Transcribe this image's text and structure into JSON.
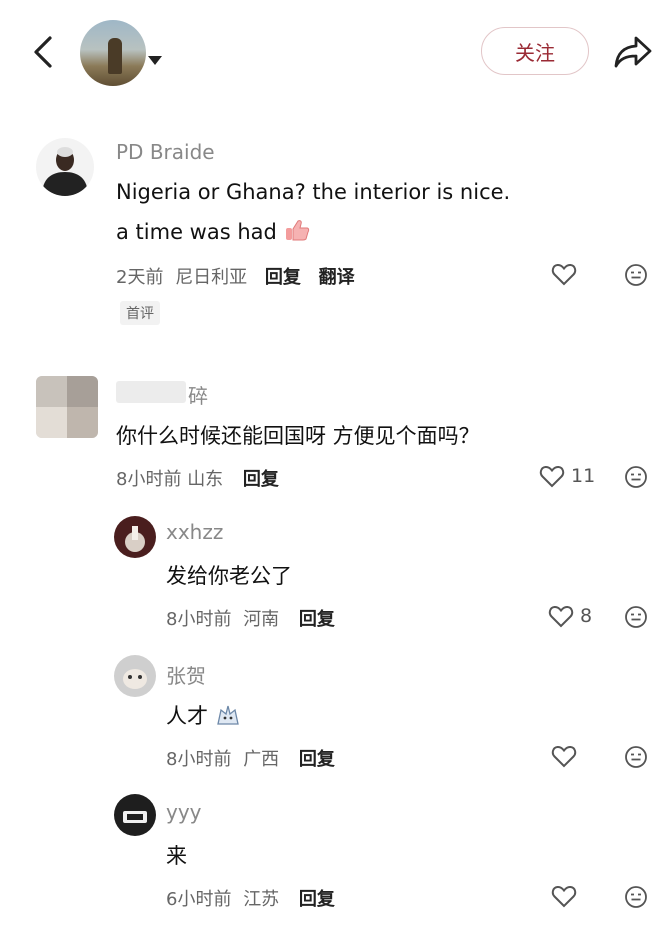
{
  "header": {
    "follow_label": "关注"
  },
  "comments": [
    {
      "user": "PD Braide",
      "line1": "Nigeria or Ghana? the interior is nice.",
      "line2": "a time was had",
      "time": "2天前",
      "location": "尼日利亚",
      "reply_label": "回复",
      "translate_label": "翻译",
      "tag": "首评"
    },
    {
      "user": "碎",
      "text": "你什么时候还能回国呀 方便见个面吗？",
      "time": "8小时前",
      "location": "山东",
      "reply_label": "回复",
      "likes": "11"
    }
  ],
  "replies": [
    {
      "user": "xxhzz",
      "text": "发给你老公了",
      "time": "8小时前",
      "location": "河南",
      "reply_label": "回复",
      "likes": "8"
    },
    {
      "user": "张贺",
      "text": "人才",
      "time": "8小时前",
      "location": "广西",
      "reply_label": "回复"
    },
    {
      "user": "yyy",
      "text": "来",
      "time": "6小时前",
      "location": "江苏",
      "reply_label": "回复"
    }
  ],
  "colors": {
    "follow_text": "#9a2a34",
    "follow_border": "#e2c6c8",
    "name": "#888888"
  },
  "icons": [
    "back-arrow-icon",
    "share-arrow-icon",
    "heart-icon",
    "comment-emoji-icon",
    "thumbs-up-emoji-icon",
    "sweat-emoji-icon"
  ]
}
